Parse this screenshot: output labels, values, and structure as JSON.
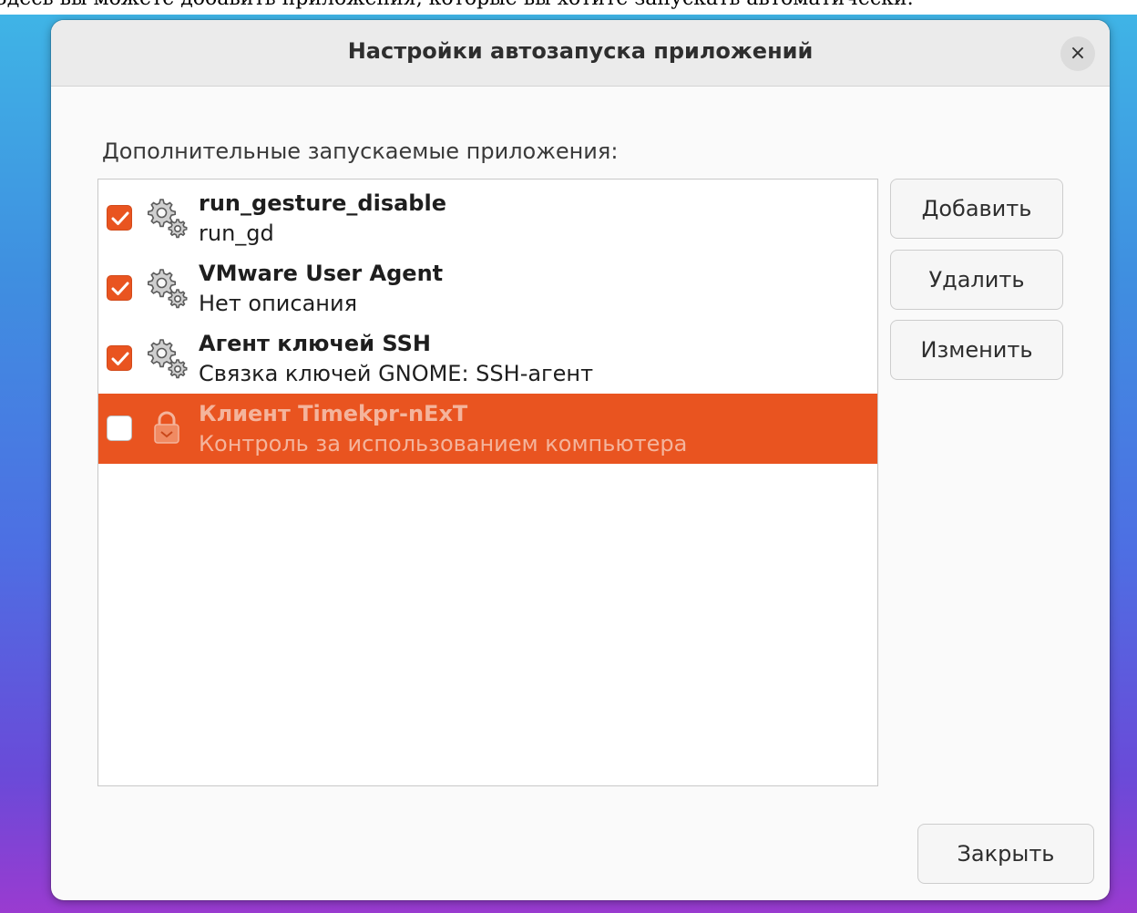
{
  "caption": "Здесь вы можете добавить приложения, которые вы хотите запускать автоматически.",
  "dialog": {
    "title": "Настройки автозапуска приложений",
    "close_icon": "×",
    "section_label": "Дополнительные запускаемые приложения:",
    "apps": [
      {
        "name": "run_gesture_disable",
        "description": "run_gd",
        "checked": true,
        "icon": "gears-icon",
        "selected": false
      },
      {
        "name": "VMware User Agent",
        "description": "Нет описания",
        "checked": true,
        "icon": "gears-icon",
        "selected": false
      },
      {
        "name": "Агент ключей SSH",
        "description": "Связка ключей GNOME: SSH-агент",
        "checked": true,
        "icon": "gears-icon",
        "selected": false
      },
      {
        "name": "Клиент Timekpr-nExT",
        "description": "Контроль за использованием компьютера",
        "checked": false,
        "icon": "padlock-icon",
        "selected": true
      }
    ],
    "buttons": {
      "add": "Добавить",
      "remove": "Удалить",
      "edit": "Изменить",
      "close": "Закрыть"
    },
    "colors": {
      "accent": "#e95420",
      "selected_text": "#f4b49c"
    }
  }
}
